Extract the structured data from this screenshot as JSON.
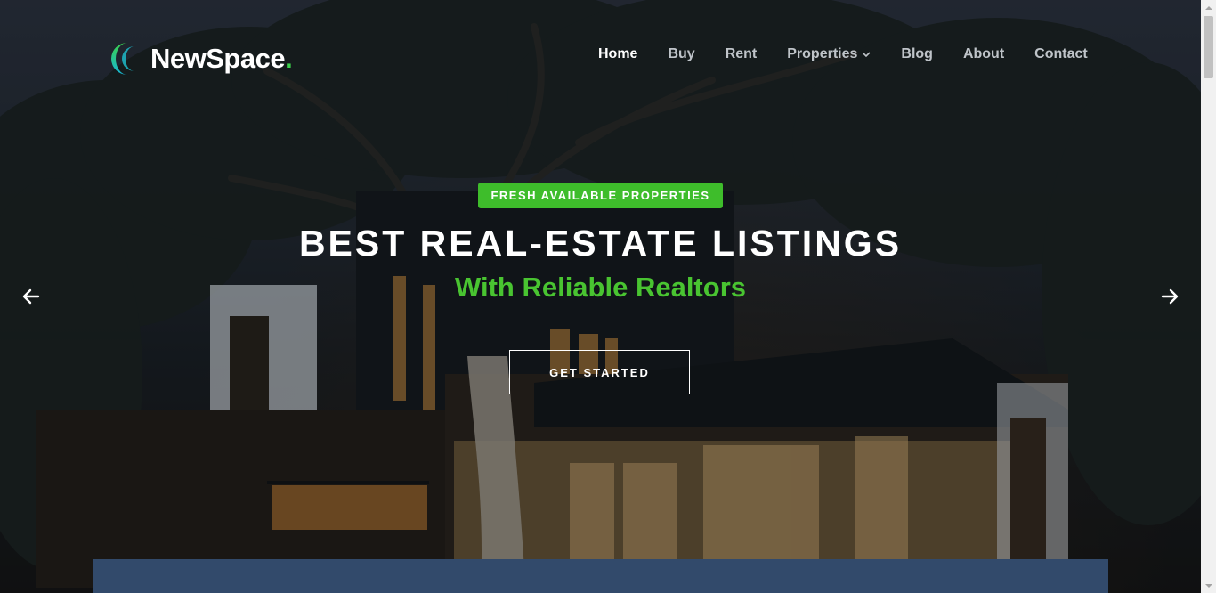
{
  "brand": {
    "name": "NewSpace",
    "dot": ".",
    "accent": "#3bd24b"
  },
  "nav": {
    "items": [
      {
        "label": "Home",
        "active": true
      },
      {
        "label": "Buy"
      },
      {
        "label": "Rent"
      },
      {
        "label": "Properties",
        "has_dropdown": true
      },
      {
        "label": "Blog"
      },
      {
        "label": "About"
      },
      {
        "label": "Contact"
      }
    ]
  },
  "hero": {
    "badge": "FRESH AVAILABLE PROPERTIES",
    "title": "BEST REAL-ESTATE LISTINGS",
    "subtitle": "With Reliable Realtors",
    "cta_label": "GET STARTED",
    "badge_color": "#3ebd2b",
    "subtitle_color": "#49c431"
  },
  "carousel": {
    "prev_icon": "arrow-left-icon",
    "next_icon": "arrow-right-icon"
  },
  "search_panel": {
    "color": "#324a6b"
  }
}
